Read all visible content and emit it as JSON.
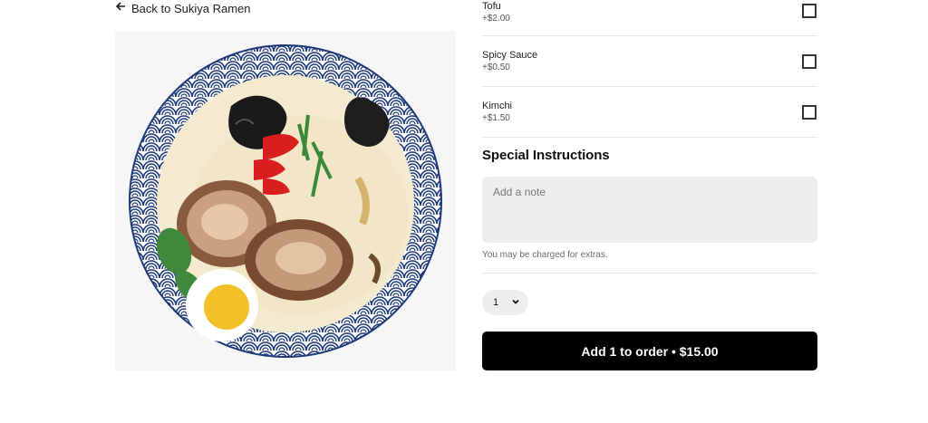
{
  "nav": {
    "back_label": "Back to Sukiya Ramen"
  },
  "item": {
    "image_alt": "Ramen bowl"
  },
  "options": [
    {
      "name": "Tofu",
      "price": "+$2.00",
      "checked": false
    },
    {
      "name": "Spicy Sauce",
      "price": "+$0.50",
      "checked": false
    },
    {
      "name": "Kimchi",
      "price": "+$1.50",
      "checked": false
    }
  ],
  "special": {
    "title": "Special Instructions",
    "placeholder": "Add a note",
    "extras_note": "You may be charged for extras."
  },
  "quantity": {
    "value": "1"
  },
  "add_button": {
    "label": "Add 1 to order • $15.00"
  },
  "colors": {
    "button_bg": "#000000",
    "field_bg": "#eeeeee",
    "divider": "#e6e6e6"
  }
}
